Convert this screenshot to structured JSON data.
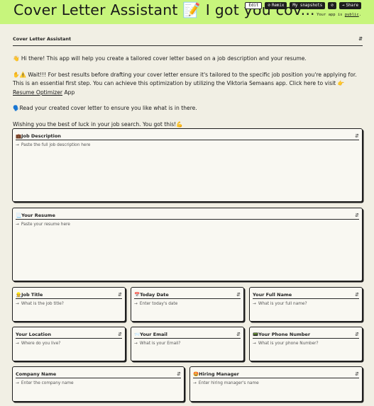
{
  "header": {
    "title": "Cover Letter Assistant 📝 I got you cov...",
    "buttons": [
      {
        "label": "Edit",
        "icon": ""
      },
      {
        "label": "Remix",
        "icon": "⊘"
      },
      {
        "label": "My snapshots",
        "icon": ""
      },
      {
        "label": "",
        "icon": "⊘"
      },
      {
        "label": "Share",
        "icon": "→"
      }
    ],
    "public_prefix": "Your app is ",
    "public_link": "public",
    "public_suffix": "."
  },
  "intro": {
    "heading": "Cover Letter Assistant",
    "p1": "👋 Hi there! This app will help you create a tailored cover letter based on a job description and your resume.",
    "p2_pre": "✋⚠️ Wait!!! For best results before drafting your cover letter ensure it's tailored to the specific job position you're applying for. This is an essential first step. You can achieve this optimization by utilizing the Viktoria Semaans app. Click here to visit 👉 ",
    "p2_link": "Resume Optimizer",
    "p2_post": " App",
    "p3": "🗣️Read your created cover letter to ensure you like what is in there.",
    "p4": "Wishing you the best of luck in your job search. You got this!💪"
  },
  "fields": {
    "job_description": {
      "label": "💼Job Description",
      "placeholder": "Paste the full job description here"
    },
    "resume": {
      "label": "📃Your Resume",
      "placeholder": "Paste your resume here"
    },
    "job_title": {
      "label": "👷Job Title",
      "placeholder": "What is the job title?"
    },
    "today_date": {
      "label": "📅Today Date",
      "placeholder": "Enter today's date"
    },
    "full_name": {
      "label": "Your Full Name",
      "placeholder": "What is your full name?"
    },
    "location": {
      "label": "Your Location",
      "placeholder": "Where do you live?"
    },
    "email": {
      "label": "📨Your Email",
      "placeholder": "What is your Email?"
    },
    "phone": {
      "label": "📟Your Phone Number",
      "placeholder": "What is your phone Number?"
    },
    "company": {
      "label": "Company Name",
      "placeholder": "Enter the company name"
    },
    "hiring_manager": {
      "label": "🤩Hiring Manager",
      "placeholder": "Enter hiring manager's name"
    }
  },
  "icons": {
    "toggle": "chevron-updown-icon",
    "input_arrow": "arrow-right-icon"
  },
  "colors": {
    "header_bg": "#c7f57c",
    "page_bg": "#f1efe4",
    "card_bg": "#f9f8f2",
    "border": "#1e1e1e"
  }
}
